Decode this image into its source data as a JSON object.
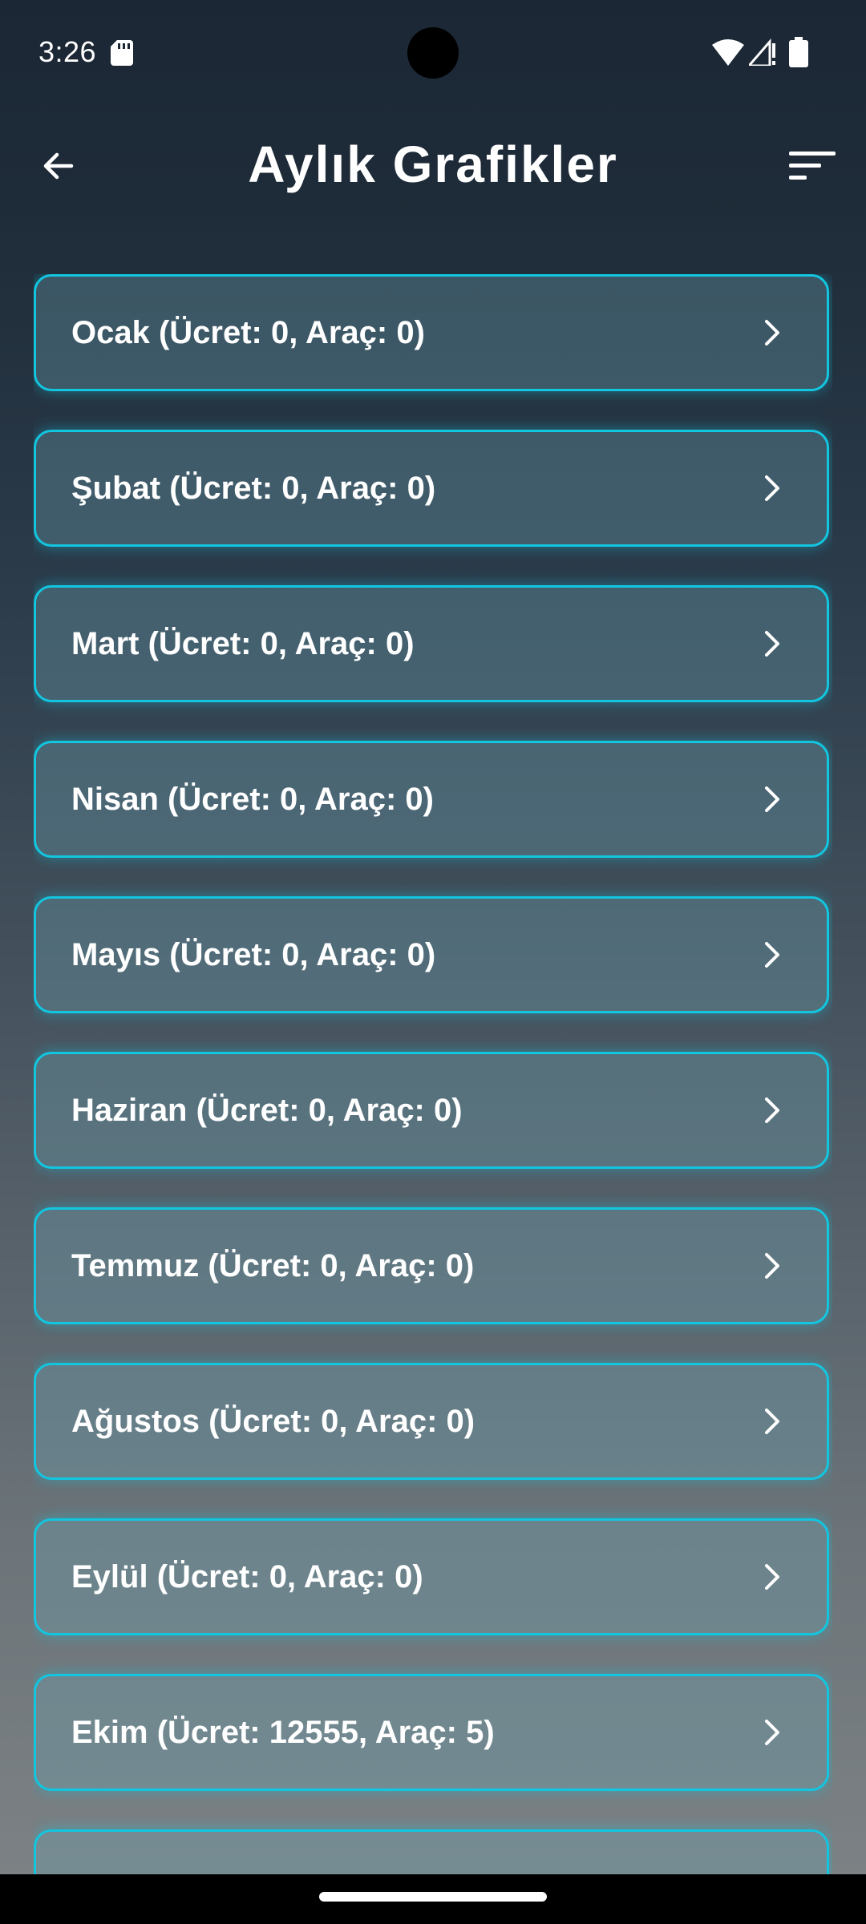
{
  "status_bar": {
    "time": "3:26",
    "icons": [
      "sd-card-icon",
      "wifi-icon",
      "signal-icon",
      "battery-icon"
    ]
  },
  "app_bar": {
    "title": "Aylık Grafikler",
    "back_icon": "arrow-left-icon",
    "sort_icon": "sort-icon"
  },
  "months": [
    {
      "label": "Ocak (Ücret: 0, Araç: 0)"
    },
    {
      "label": "Şubat (Ücret: 0, Araç: 0)"
    },
    {
      "label": "Mart (Ücret: 0, Araç: 0)"
    },
    {
      "label": "Nisan (Ücret: 0, Araç: 0)"
    },
    {
      "label": "Mayıs (Ücret: 0, Araç: 0)"
    },
    {
      "label": "Haziran (Ücret: 0, Araç: 0)"
    },
    {
      "label": "Temmuz (Ücret: 0, Araç: 0)"
    },
    {
      "label": "Ağustos (Ücret: 0, Araç: 0)"
    },
    {
      "label": "Eylül (Ücret: 0, Araç: 0)"
    },
    {
      "label": "Ekim (Ücret: 12555, Araç: 5)"
    },
    {
      "label": ""
    }
  ],
  "colors": {
    "accent": "#12c6e0",
    "background_top": "#1b2735",
    "background_bottom": "#7e8386",
    "text": "#ffffff"
  }
}
